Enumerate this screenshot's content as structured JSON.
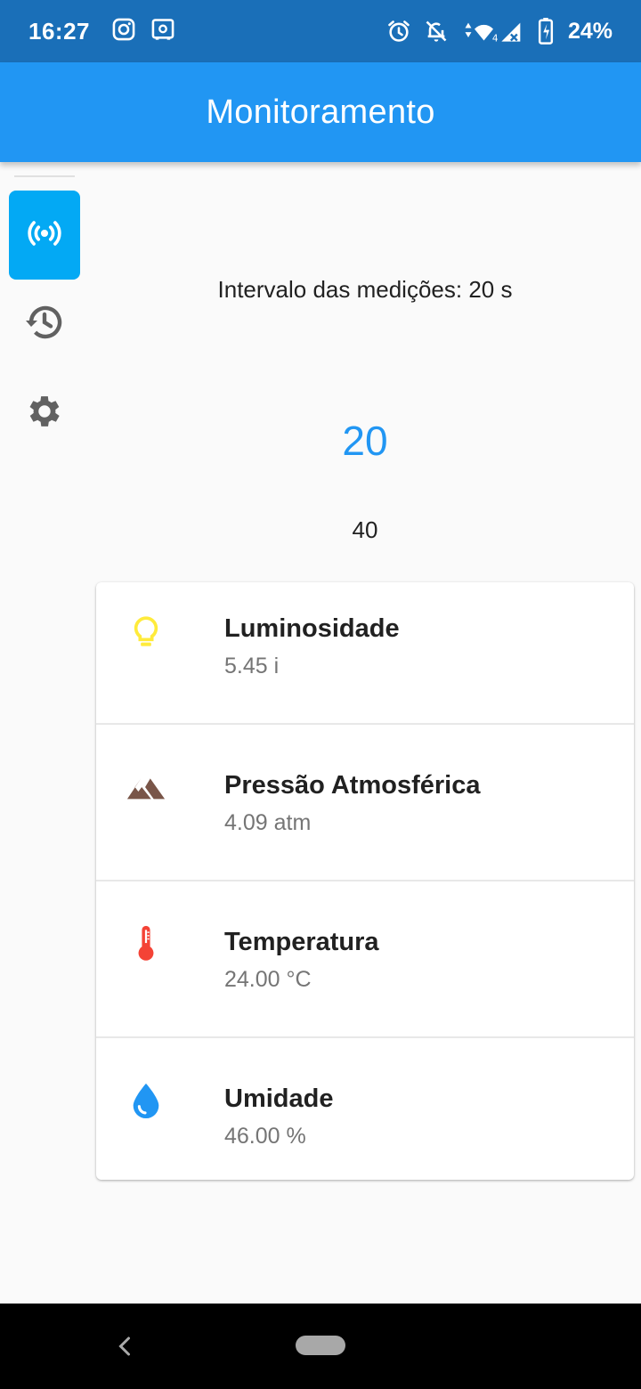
{
  "status_bar": {
    "time": "16:27",
    "battery": "24%",
    "network": "4"
  },
  "app_bar": {
    "title": "Monitoramento"
  },
  "nav_rail": {
    "items": [
      {
        "name": "monitor",
        "icon": "wifi-tethering-icon",
        "active": true
      },
      {
        "name": "history",
        "icon": "history-icon",
        "active": false
      },
      {
        "name": "settings",
        "icon": "gear-icon",
        "active": false
      }
    ],
    "active_color": "#03a9f4"
  },
  "interval": {
    "label": "Intervalo das medições: 20 s",
    "picker_selected": "20",
    "picker_next": "40"
  },
  "sensors": [
    {
      "title": "Luminosidade",
      "value": "5.45 i",
      "icon": "lightbulb-icon",
      "color": "#ffeb3b"
    },
    {
      "title": "Pressão Atmosférica",
      "value": "4.09 atm",
      "icon": "terrain-icon",
      "color": "#795548"
    },
    {
      "title": "Temperatura",
      "value": "24.00 °C",
      "icon": "thermometer-icon",
      "color": "#f44336"
    },
    {
      "title": "Umidade",
      "value": "46.00 %",
      "icon": "water-drop-icon",
      "color": "#2196f3"
    }
  ],
  "colors": {
    "primary": "#2196f3",
    "status_bar": "#1a6fb8"
  }
}
